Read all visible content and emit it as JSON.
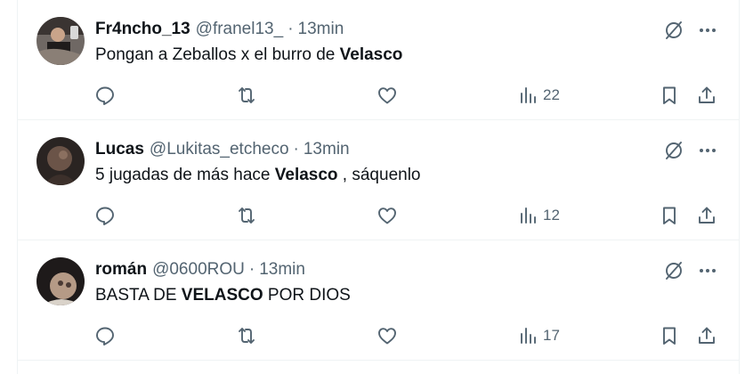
{
  "tweets": [
    {
      "name": "Fr4ncho_13",
      "handle": "@franel13_",
      "separator": "·",
      "time": "13min",
      "text_before": "Pongan a Zeballos x el burro de ",
      "text_bold": "Velasco",
      "text_after": "",
      "views": "22"
    },
    {
      "name": "Lucas",
      "handle": "@Lukitas_etcheco",
      "separator": "·",
      "time": "13min",
      "text_before": "5 jugadas de más hace ",
      "text_bold": "Velasco",
      "text_after": " , sáquenlo",
      "views": "12"
    },
    {
      "name": "román",
      "handle": "@0600ROU",
      "separator": "·",
      "time": "13min",
      "text_before": "BASTA DE ",
      "text_bold": "VELASCO",
      "text_after": " POR DIOS",
      "views": "17"
    }
  ],
  "icons": {
    "reply": "reply-icon",
    "retweet": "retweet-icon",
    "like": "like-icon",
    "views": "views-icon",
    "bookmark": "bookmark-icon",
    "share": "share-icon",
    "grok": "grok-icon",
    "more": "more-icon"
  },
  "colors": {
    "text": "#0f1419",
    "secondary": "#536471",
    "border": "#eff3f4"
  }
}
